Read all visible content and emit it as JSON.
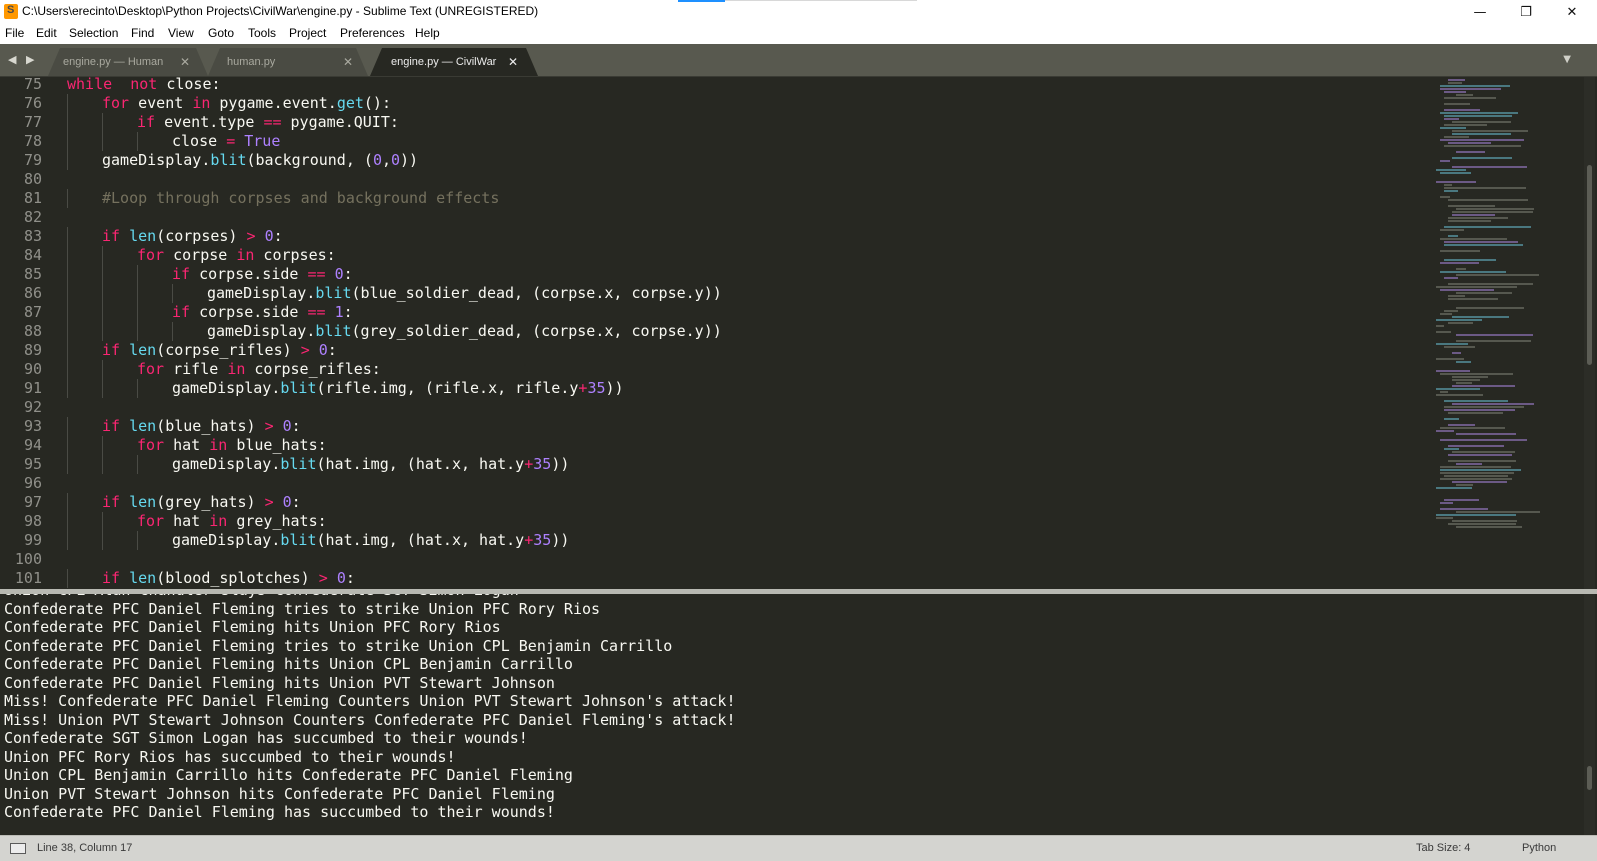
{
  "window": {
    "title": "C:\\Users\\erecinto\\Desktop\\Python Projects\\CivilWar\\engine.py - Sublime Text (UNREGISTERED)",
    "minimize_glyph": "—",
    "maximize_glyph": "❐",
    "close_glyph": "✕"
  },
  "menu": [
    "File",
    "Edit",
    "Selection",
    "Find",
    "View",
    "Goto",
    "Tools",
    "Project",
    "Preferences",
    "Help"
  ],
  "tabs": [
    {
      "label": "engine.py — Human",
      "active": false
    },
    {
      "label": "human.py",
      "active": false
    },
    {
      "label": "engine.py — CivilWar",
      "active": true
    }
  ],
  "tab_close_glyph": "✕",
  "nav_arrows": "◀ ▶",
  "tab_menu_glyph": "▼",
  "editor": {
    "lines": [
      {
        "n": "75",
        "indent": 0,
        "tokens": [
          [
            "kw",
            "while"
          ],
          [
            "",
            "  "
          ],
          [
            "kw",
            "not"
          ],
          [
            "",
            " close:"
          ]
        ]
      },
      {
        "n": "76",
        "indent": 1,
        "tokens": [
          [
            "kw",
            "for"
          ],
          [
            "",
            " event "
          ],
          [
            "kw",
            "in"
          ],
          [
            "",
            " pygame.event."
          ],
          [
            "fn",
            "get"
          ],
          [
            "",
            "():"
          ]
        ]
      },
      {
        "n": "77",
        "indent": 2,
        "tokens": [
          [
            "kw",
            "if"
          ],
          [
            "",
            " event.type "
          ],
          [
            "kw",
            "=="
          ],
          [
            "",
            " pygame.QUIT:"
          ]
        ]
      },
      {
        "n": "78",
        "indent": 3,
        "tokens": [
          [
            "",
            "close "
          ],
          [
            "kw",
            "="
          ],
          [
            "",
            " "
          ],
          [
            "num",
            "True"
          ]
        ]
      },
      {
        "n": "79",
        "indent": 1,
        "tokens": [
          [
            "",
            "gameDisplay."
          ],
          [
            "fn",
            "blit"
          ],
          [
            "",
            "(background, ("
          ],
          [
            "num",
            "0"
          ],
          [
            "",
            ","
          ],
          [
            "num",
            "0"
          ],
          [
            "",
            "))"
          ]
        ]
      },
      {
        "n": "80",
        "indent": 0,
        "tokens": []
      },
      {
        "n": "81",
        "indent": 1,
        "tokens": [
          [
            "cm",
            "#Loop through corpses and background effects"
          ]
        ]
      },
      {
        "n": "82",
        "indent": 0,
        "tokens": []
      },
      {
        "n": "83",
        "indent": 1,
        "tokens": [
          [
            "kw",
            "if"
          ],
          [
            "",
            " "
          ],
          [
            "fn",
            "len"
          ],
          [
            "",
            "(corpses) "
          ],
          [
            "kw",
            ">"
          ],
          [
            "",
            " "
          ],
          [
            "num",
            "0"
          ],
          [
            "",
            ":"
          ]
        ]
      },
      {
        "n": "84",
        "indent": 2,
        "tokens": [
          [
            "kw",
            "for"
          ],
          [
            "",
            " corpse "
          ],
          [
            "kw",
            "in"
          ],
          [
            "",
            " corpses:"
          ]
        ]
      },
      {
        "n": "85",
        "indent": 3,
        "tokens": [
          [
            "kw",
            "if"
          ],
          [
            "",
            " corpse.side "
          ],
          [
            "kw",
            "=="
          ],
          [
            "",
            " "
          ],
          [
            "num",
            "0"
          ],
          [
            "",
            ":"
          ]
        ]
      },
      {
        "n": "86",
        "indent": 4,
        "tokens": [
          [
            "",
            "gameDisplay."
          ],
          [
            "fn",
            "blit"
          ],
          [
            "",
            "(blue_soldier_dead, (corpse.x, corpse.y))"
          ]
        ]
      },
      {
        "n": "87",
        "indent": 3,
        "tokens": [
          [
            "kw",
            "if"
          ],
          [
            "",
            " corpse.side "
          ],
          [
            "kw",
            "=="
          ],
          [
            "",
            " "
          ],
          [
            "num",
            "1"
          ],
          [
            "",
            ":"
          ]
        ]
      },
      {
        "n": "88",
        "indent": 4,
        "tokens": [
          [
            "",
            "gameDisplay."
          ],
          [
            "fn",
            "blit"
          ],
          [
            "",
            "(grey_soldier_dead, (corpse.x, corpse.y))"
          ]
        ]
      },
      {
        "n": "89",
        "indent": 1,
        "tokens": [
          [
            "kw",
            "if"
          ],
          [
            "",
            " "
          ],
          [
            "fn",
            "len"
          ],
          [
            "",
            "(corpse_rifles) "
          ],
          [
            "kw",
            ">"
          ],
          [
            "",
            " "
          ],
          [
            "num",
            "0"
          ],
          [
            "",
            ":"
          ]
        ]
      },
      {
        "n": "90",
        "indent": 2,
        "tokens": [
          [
            "kw",
            "for"
          ],
          [
            "",
            " rifle "
          ],
          [
            "kw",
            "in"
          ],
          [
            "",
            " corpse_rifles:"
          ]
        ]
      },
      {
        "n": "91",
        "indent": 3,
        "tokens": [
          [
            "",
            "gameDisplay."
          ],
          [
            "fn",
            "blit"
          ],
          [
            "",
            "(rifle.img, (rifle.x, rifle.y"
          ],
          [
            "kw",
            "+"
          ],
          [
            "num",
            "35"
          ],
          [
            "",
            "))"
          ]
        ]
      },
      {
        "n": "92",
        "indent": 0,
        "tokens": []
      },
      {
        "n": "93",
        "indent": 1,
        "tokens": [
          [
            "kw",
            "if"
          ],
          [
            "",
            " "
          ],
          [
            "fn",
            "len"
          ],
          [
            "",
            "(blue_hats) "
          ],
          [
            "kw",
            ">"
          ],
          [
            "",
            " "
          ],
          [
            "num",
            "0"
          ],
          [
            "",
            ":"
          ]
        ]
      },
      {
        "n": "94",
        "indent": 2,
        "tokens": [
          [
            "kw",
            "for"
          ],
          [
            "",
            " hat "
          ],
          [
            "kw",
            "in"
          ],
          [
            "",
            " blue_hats:"
          ]
        ]
      },
      {
        "n": "95",
        "indent": 3,
        "tokens": [
          [
            "",
            "gameDisplay."
          ],
          [
            "fn",
            "blit"
          ],
          [
            "",
            "(hat.img, (hat.x, hat.y"
          ],
          [
            "kw",
            "+"
          ],
          [
            "num",
            "35"
          ],
          [
            "",
            "))"
          ]
        ]
      },
      {
        "n": "96",
        "indent": 0,
        "tokens": []
      },
      {
        "n": "97",
        "indent": 1,
        "tokens": [
          [
            "kw",
            "if"
          ],
          [
            "",
            " "
          ],
          [
            "fn",
            "len"
          ],
          [
            "",
            "(grey_hats) "
          ],
          [
            "kw",
            ">"
          ],
          [
            "",
            " "
          ],
          [
            "num",
            "0"
          ],
          [
            "",
            ":"
          ]
        ]
      },
      {
        "n": "98",
        "indent": 2,
        "tokens": [
          [
            "kw",
            "for"
          ],
          [
            "",
            " hat "
          ],
          [
            "kw",
            "in"
          ],
          [
            "",
            " grey_hats:"
          ]
        ]
      },
      {
        "n": "99",
        "indent": 3,
        "tokens": [
          [
            "",
            "gameDisplay."
          ],
          [
            "fn",
            "blit"
          ],
          [
            "",
            "(hat.img, (hat.x, hat.y"
          ],
          [
            "kw",
            "+"
          ],
          [
            "num",
            "35"
          ],
          [
            "",
            "))"
          ]
        ]
      },
      {
        "n": "100",
        "indent": 0,
        "tokens": []
      },
      {
        "n": "101",
        "indent": 1,
        "tokens": [
          [
            "kw",
            "if"
          ],
          [
            "",
            " "
          ],
          [
            "fn",
            "len"
          ],
          [
            "",
            "(blood_splotches) "
          ],
          [
            "kw",
            ">"
          ],
          [
            "",
            " "
          ],
          [
            "num",
            "0"
          ],
          [
            "",
            ":"
          ]
        ]
      }
    ]
  },
  "output": [
    "Union CPL Alan Chandler slays Confederate SGT Simon Logan",
    "Confederate PFC Daniel Fleming tries to strike Union PFC Rory Rios",
    "Confederate PFC Daniel Fleming hits Union PFC Rory Rios",
    "Confederate PFC Daniel Fleming tries to strike Union CPL Benjamin Carrillo",
    "Confederate PFC Daniel Fleming hits Union CPL Benjamin Carrillo",
    "Confederate PFC Daniel Fleming hits Union PVT Stewart Johnson",
    "Miss! Confederate PFC Daniel Fleming Counters Union PVT Stewart Johnson's attack!",
    "Miss! Union PVT Stewart Johnson Counters Confederate PFC Daniel Fleming's attack!",
    "Confederate SGT Simon Logan has succumbed to their wounds!",
    "Union PFC Rory Rios has succumbed to their wounds!",
    "Union CPL Benjamin Carrillo hits Confederate PFC Daniel Fleming",
    "Union PVT Stewart Johnson hits Confederate PFC Daniel Fleming",
    "Confederate PFC Daniel Fleming has succumbed to their wounds!"
  ],
  "status": {
    "position": "Line 38, Column 17",
    "tab_size": "Tab Size: 4",
    "syntax": "Python"
  },
  "colors": {
    "editor_bg": "#272822",
    "keyword": "#f92672",
    "function": "#66d9ef",
    "number": "#ae81ff",
    "comment": "#75715e"
  }
}
